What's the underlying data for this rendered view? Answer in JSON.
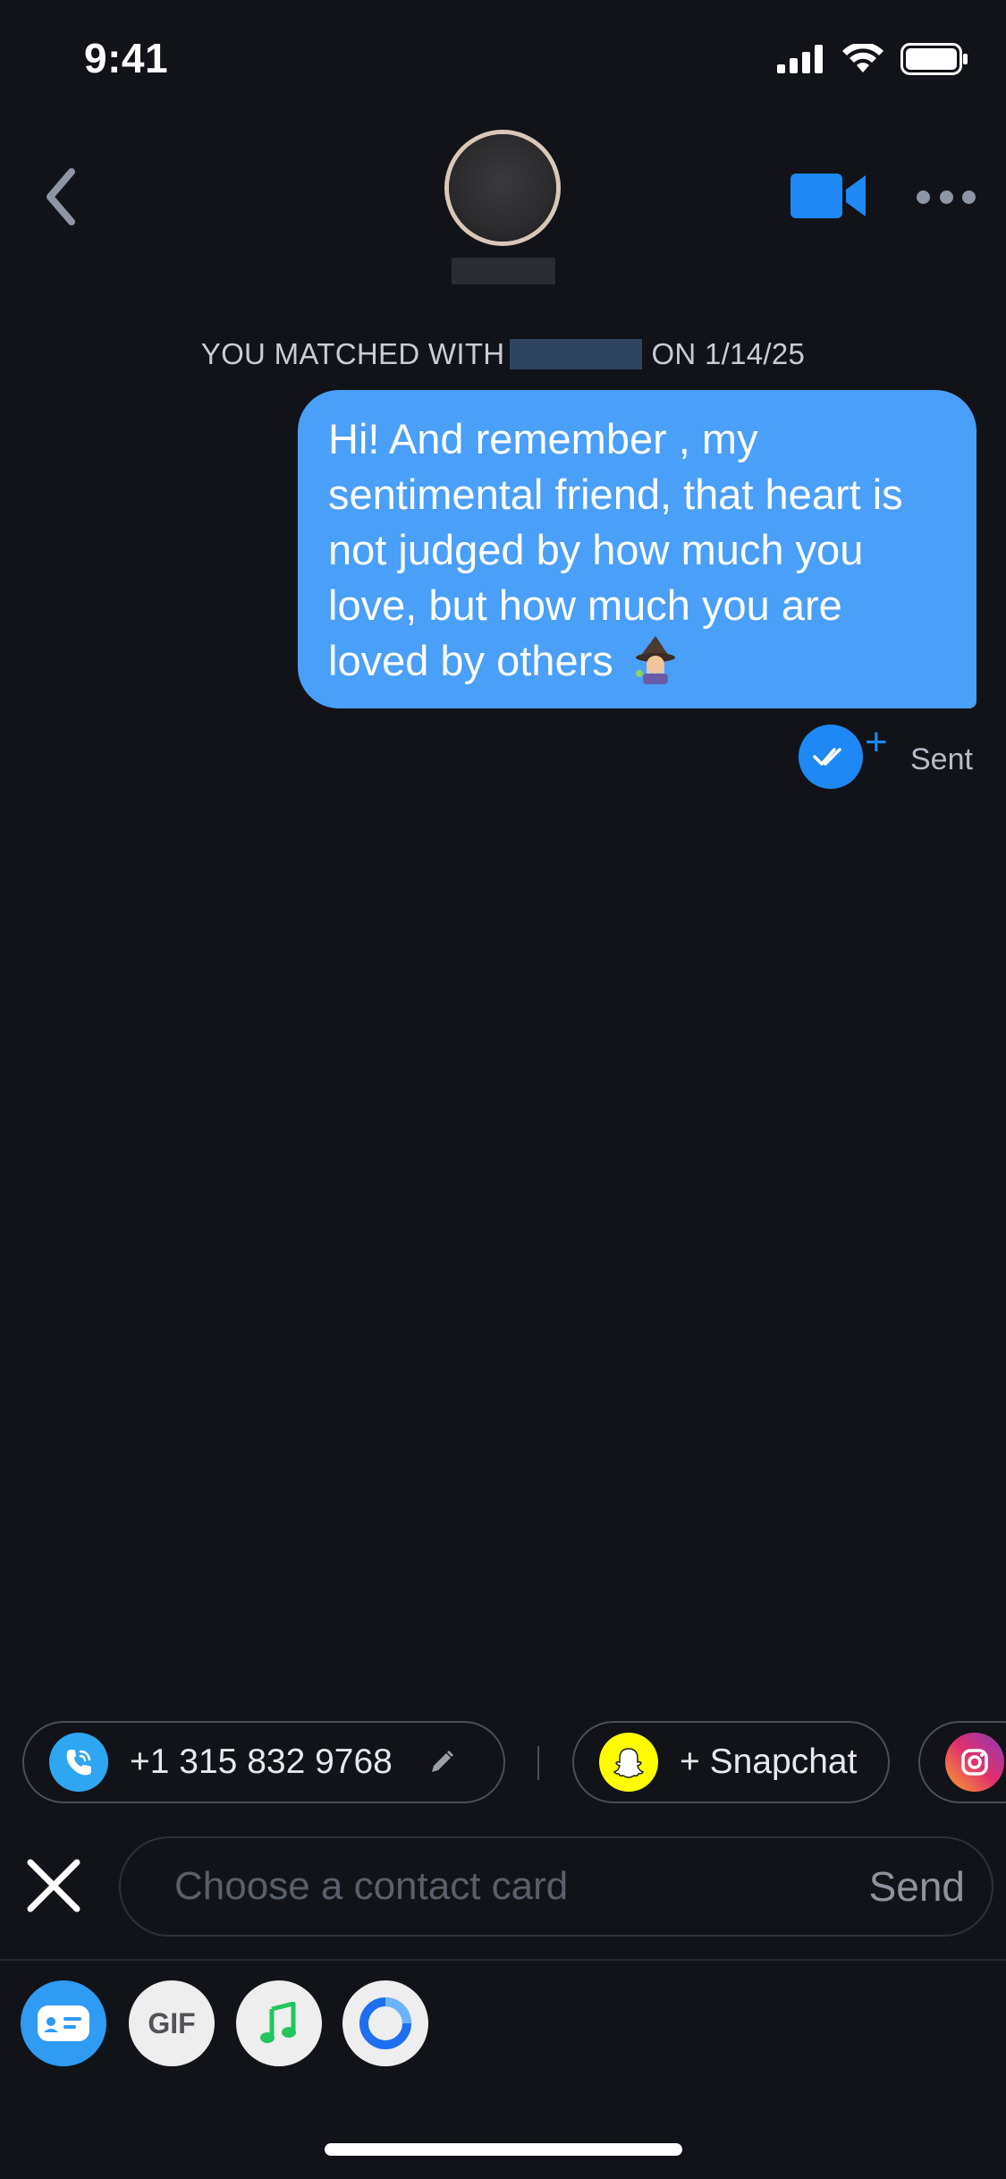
{
  "status_bar": {
    "time": "9:41"
  },
  "header": {
    "back_icon": "chevron-left-icon",
    "video_icon": "video-camera-icon",
    "more_icon": "more-dots-icon",
    "accent_color": "#1e88f5"
  },
  "match_banner": {
    "prefix": "YOU MATCHED WITH",
    "suffix": "ON 1/14/25"
  },
  "message": {
    "text": "Hi! And remember , my sentimental friend, that heart is not judged by how much you love, but how much you are loved by others",
    "emoji": "wizard-emoji",
    "bubble_color": "#4a9ff8",
    "status": "Sent",
    "receipt_plus": "+"
  },
  "chips": {
    "phone": {
      "label": "+1 315 832 9768",
      "icon": "phone-icon",
      "edit_icon": "pencil-icon"
    },
    "snapchat": {
      "label": "+ Snapchat",
      "icon": "snapchat-ghost-icon"
    },
    "instagram": {
      "icon": "instagram-icon"
    }
  },
  "composer": {
    "placeholder": "Choose a contact card",
    "send_label": "Send",
    "close_icon": "close-x-icon"
  },
  "toolbar": {
    "card_icon": "contact-card-icon",
    "gif_label": "GIF",
    "music_icon": "music-note-icon",
    "circle_icon": "circle-ring-icon"
  }
}
